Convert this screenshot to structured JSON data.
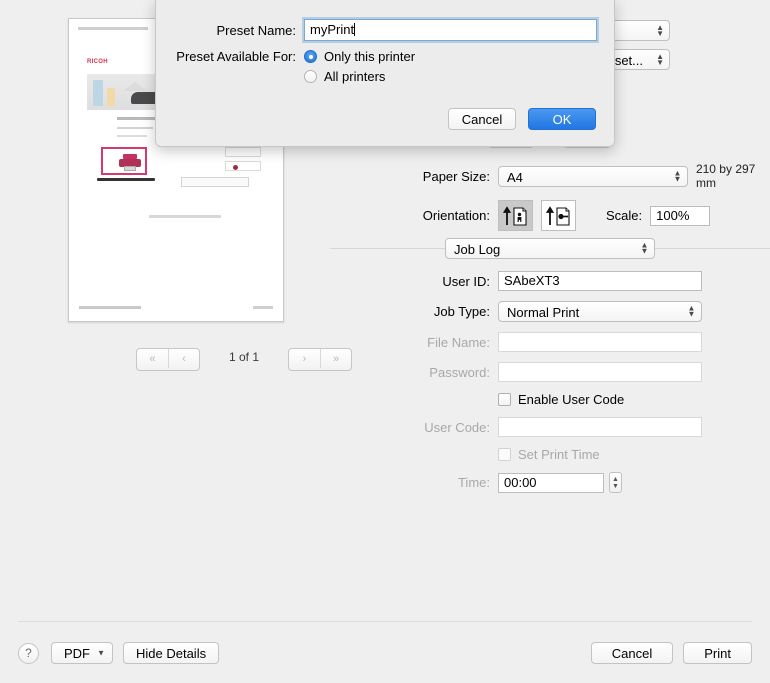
{
  "preview": {
    "document_brand": "RICOH",
    "pager": {
      "first_label": "«",
      "prev_label": "‹",
      "page_indicator": "1 of 1",
      "next_label": "›",
      "last_label": "»"
    }
  },
  "settings": {
    "printer_popup_value": "",
    "presets_popup_value": "set...",
    "paper_size": {
      "label": "Paper Size:",
      "value": "A4",
      "dimensions_hint": "210 by 297 mm"
    },
    "orientation": {
      "label": "Orientation:",
      "portrait_name": "portrait",
      "landscape_name": "landscape",
      "selected": "portrait"
    },
    "scale": {
      "label": "Scale:",
      "value": "100%"
    },
    "pane_selector": {
      "value": "Job Log"
    },
    "job_log": {
      "user_id": {
        "label": "User ID:",
        "value": "SAbeXT3",
        "enabled": true
      },
      "job_type": {
        "label": "Job Type:",
        "value": "Normal Print",
        "enabled": true
      },
      "file_name": {
        "label": "File Name:",
        "value": "",
        "enabled": false
      },
      "password": {
        "label": "Password:",
        "value": "",
        "enabled": false
      },
      "enable_user_code": {
        "label": "Enable User Code",
        "checked": false,
        "enabled": true
      },
      "user_code": {
        "label": "User Code:",
        "value": "",
        "enabled": false
      },
      "set_print_time": {
        "label": "Set Print Time",
        "checked": false,
        "enabled": false
      },
      "time": {
        "label": "Time:",
        "value": "00:00",
        "enabled": true
      }
    }
  },
  "bottom_bar": {
    "help_label": "?",
    "pdf_label": "PDF",
    "hide_details_label": "Hide Details",
    "cancel_label": "Cancel",
    "print_label": "Print"
  },
  "sheet": {
    "preset_name": {
      "label": "Preset Name:",
      "value": "myPrint"
    },
    "preset_available_for": {
      "label": "Preset Available For:",
      "options": [
        {
          "label": "Only this printer",
          "selected": true
        },
        {
          "label": "All printers",
          "selected": false
        }
      ]
    },
    "cancel_label": "Cancel",
    "ok_label": "OK"
  },
  "colors": {
    "window_background": "#efefef",
    "accent_blue": "#2176e2",
    "focus_ring": "#7aa9d6",
    "brand_red": "#d8304a",
    "printer_pink": "#d6396b",
    "disabled_text": "#a8a8a8"
  }
}
